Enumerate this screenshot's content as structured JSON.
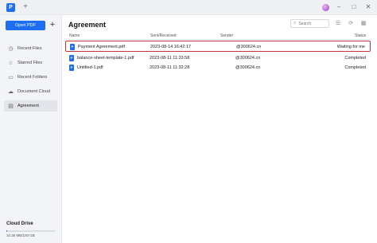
{
  "topbar": {
    "logo": "P",
    "new_tab": "+",
    "minimize": "–",
    "maximize": "□",
    "close": "✕"
  },
  "sidebar": {
    "open_pdf_label": "Open PDF",
    "plus_label": "+",
    "items": [
      {
        "label": "Recent Files",
        "icon": "clock-icon",
        "glyph": "◷"
      },
      {
        "label": "Starred Files",
        "icon": "star-icon",
        "glyph": "☆"
      },
      {
        "label": "Recent Folders",
        "icon": "folder-icon",
        "glyph": "▭"
      },
      {
        "label": "Document Cloud",
        "icon": "cloud-icon",
        "glyph": "☁"
      },
      {
        "label": "Agreement",
        "icon": "document-icon",
        "glyph": "▤"
      }
    ],
    "cloud_title": "Cloud Drive",
    "storage_text": "10.36 MB/100 GB",
    "storage_fraction": 0.0001
  },
  "main": {
    "title": "Agreement",
    "search_placeholder": "Search",
    "columns": {
      "name": "Name",
      "sent": "Sent/Received",
      "sender": "Sender",
      "status": "Status"
    },
    "rows": [
      {
        "name": "Payment Agreement.pdf",
        "date": "2023-08-14 16:42:17",
        "sender": "@300624.cn",
        "status": "Waiting for me"
      },
      {
        "name": "balance-sheet-template-1.pdf",
        "date": "2023-08-11 11:33:58",
        "sender": "@300624.cn",
        "status": "Completed"
      },
      {
        "name": "Untitled-1.pdf",
        "date": "2023-08-11 11:32:28",
        "sender": "@300624.cn",
        "status": "Completed"
      }
    ]
  },
  "colors": {
    "accent": "#1e6ef4",
    "highlight": "#c8323a"
  }
}
